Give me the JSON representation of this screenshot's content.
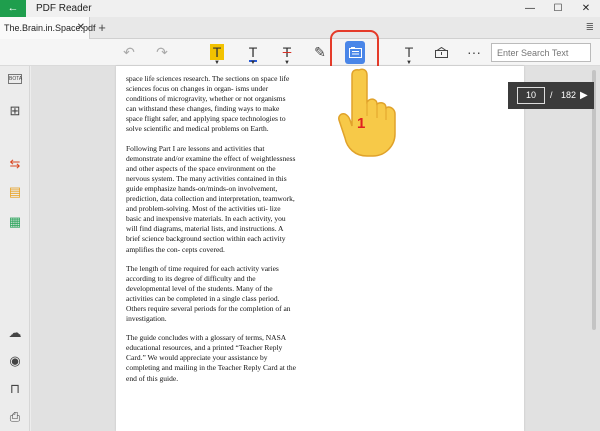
{
  "titlebar": {
    "title": "PDF Reader",
    "back_icon": "←",
    "minimize": "—",
    "maximize": "☐",
    "close": "✕"
  },
  "tabs": [
    {
      "label": "The.Brain.in.Space.pdf",
      "close": "✕"
    }
  ],
  "tab_add": "+",
  "tab_menu": "≣",
  "toolbar": {
    "undo": "↶",
    "redo": "↷",
    "highlight": "T",
    "underline": "T",
    "strikethrough": "T",
    "pen": "✎",
    "text": "T",
    "more": "···",
    "search_placeholder": "Enter Search Text"
  },
  "sidebar": {
    "bookmark_label": "BOTA"
  },
  "pager": {
    "current": "10",
    "separator": "/",
    "total": "182",
    "next": "▶"
  },
  "annotation": {
    "step": "1"
  },
  "document": {
    "paragraphs": [
      "space life sciences research. The sections on space life sciences focus on changes in organ- isms under conditions of microgravity, whether or not organisms can withstand these changes, finding ways to make space flight safer, and applying space technologies to solve scientific and medical problems on Earth.",
      "Following Part I are lessons and activities that demonstrate and/or examine the effect of weightlessness and other aspects of the space environment on the nervous system. The many activities contained in this guide emphasize hands-on/minds-on involvement, prediction, data collection and interpretation, teamwork, and problem-solving. Most of the activities uti- lize basic and inexpensive materials. In each activity, you will find diagrams, material lists, and instructions. A brief science background section within each activity amplifies the con- cepts covered.",
      "The length of time required for each activity varies according to its degree of difficulty and the developmental level of the students. Many of the activities can be completed in a single class period. Others require several periods for the completion of an investigation.",
      "The guide concludes with a glossary of terms, NASA educational resources, and a printed “Teacher Reply Card.” We would appreciate your assistance by completing and mailing in the Teacher Reply Card at the end of this guide."
    ]
  },
  "colors": {
    "accent_green": "#1f9e4d",
    "active_tool": "#4a86e8",
    "highlight_ring": "#e53b2a",
    "highlight_yellow": "#f2c200",
    "underline_blue": "#2a5bd7",
    "strike_red": "#d93025"
  }
}
